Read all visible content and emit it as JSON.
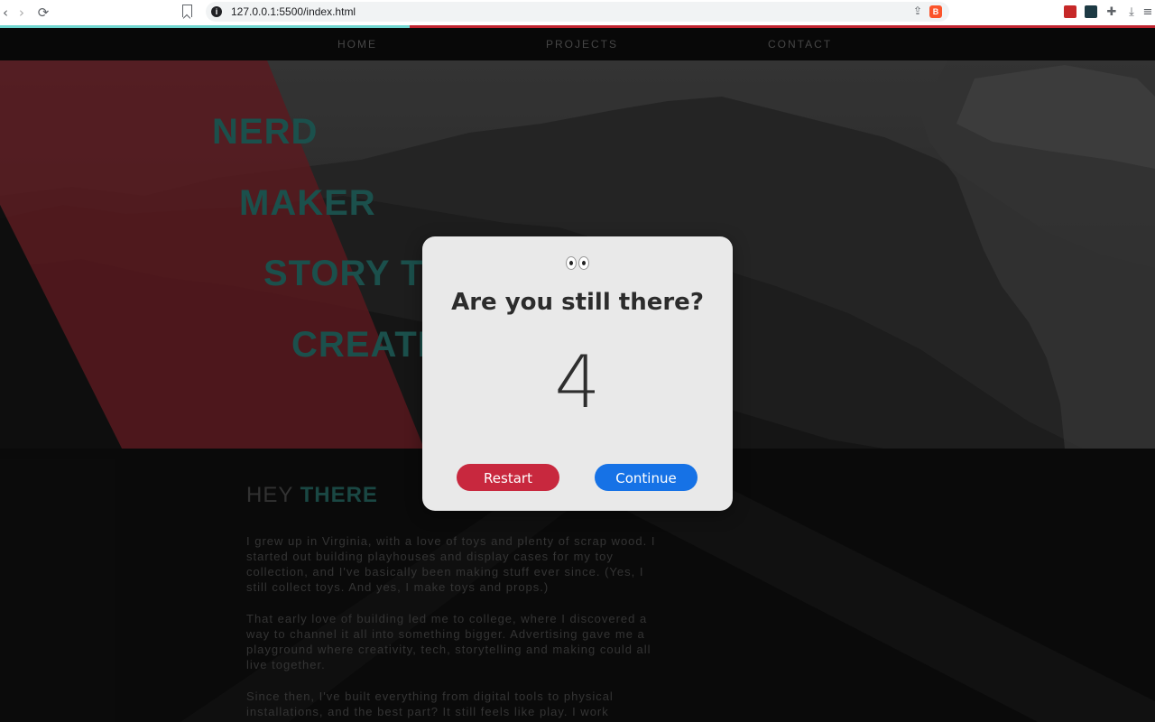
{
  "browser": {
    "url": "127.0.0.1:5500/index.html",
    "page_load_progress": 0.355
  },
  "nav": {
    "items": [
      "HOME",
      "PROJECTS",
      "CONTACT"
    ]
  },
  "hero": {
    "words": [
      "NERD",
      "MAKER",
      "STORY TELLER",
      "CREATIVE TECH"
    ]
  },
  "about": {
    "heading_light": "HEY ",
    "heading_bold": "THERE",
    "paragraphs": [
      "I grew up in Virginia, with a love of toys and plenty of scrap wood. I started out building playhouses and display cases for my toy collection, and I've basically been making stuff ever since. (Yes, I still collect toys. And yes, I make toys and props.)",
      "That early love of building led me to college, where I discovered a way to channel it all into something bigger. Advertising gave me a playground where creativity, tech, storytelling and making could all live together.",
      "Since then, I've built everything from digital tools to physical installations, and the best part? It still feels like play. I work"
    ]
  },
  "modal": {
    "title": "Are you still there?",
    "countdown": "4",
    "restart_label": "Restart",
    "continue_label": "Continue"
  },
  "colors": {
    "accent_teal": "#1f5c57",
    "restart": "#c8283e",
    "continue": "#1672e6",
    "progress_done": "#6fd5cf",
    "progress_rest": "#c0232f"
  }
}
